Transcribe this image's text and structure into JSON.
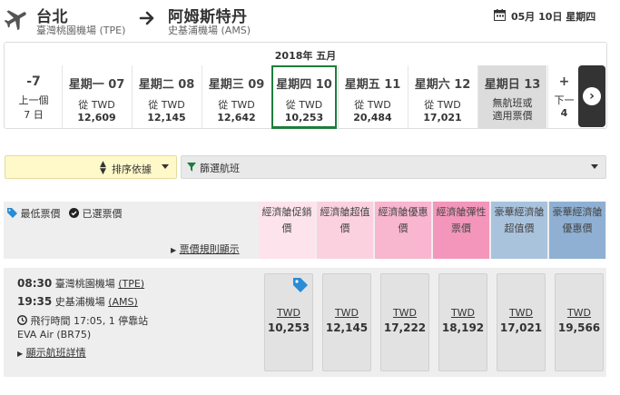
{
  "header": {
    "origin_city": "台北",
    "origin_airport": "臺灣桃園機場 (TPE)",
    "dest_city": "阿姆斯特丹",
    "dest_airport": "史基浦機場 (AMS)",
    "date": "05月 10日 星期四"
  },
  "date_strip": {
    "year_month": "2018年 五月",
    "prev": {
      "label": "-7",
      "line1": "上一個",
      "line2": "7 日"
    },
    "days": [
      {
        "name": "星期一 07",
        "from": "從 TWD",
        "price": "12,609"
      },
      {
        "name": "星期二 08",
        "from": "從 TWD",
        "price": "12,145"
      },
      {
        "name": "星期三 09",
        "from": "從 TWD",
        "price": "12,642"
      },
      {
        "name": "星期四 10",
        "from": "從 TWD",
        "price": "10,253"
      },
      {
        "name": "星期五 11",
        "from": "從 TWD",
        "price": "20,484"
      },
      {
        "name": "星期六 12",
        "from": "從 TWD",
        "price": "17,021"
      },
      {
        "name": "星期日 13",
        "from": "無航班或",
        "price": "適用票價"
      }
    ],
    "next": {
      "label": "+",
      "line1": "下一",
      "line2": "4"
    }
  },
  "sort": {
    "label": "排序依據"
  },
  "filter": {
    "label": "篩選航班"
  },
  "fare_header": {
    "lowest": "最低票價",
    "selected": "已選票價",
    "rules": "票價規則顯示",
    "columns": [
      {
        "label": "經濟艙促銷價",
        "color": "#fde3ec"
      },
      {
        "label": "經濟艙超值價",
        "color": "#fbd1e0"
      },
      {
        "label": "經濟艙優惠價",
        "color": "#f8b6cf"
      },
      {
        "label": "經濟艙彈性票價",
        "color": "#f496bb"
      },
      {
        "label": "豪華經濟艙超值價",
        "color": "#a9c3dd"
      },
      {
        "label": "豪華經濟艙優惠價",
        "color": "#8fb0d2"
      }
    ]
  },
  "flight": {
    "dep_time": "08:30",
    "dep_airport": "臺灣桃園機場",
    "dep_code": "(TPE)",
    "arr_time": "19:35",
    "arr_airport": "史基浦機場",
    "arr_code": "(AMS)",
    "duration": "飛行時間 17:05, 1 停靠站",
    "airline": "EVA Air (BR75)",
    "details": "顯示航班詳情",
    "fares": [
      {
        "currency": "TWD",
        "amount": "10,253"
      },
      {
        "currency": "TWD",
        "amount": "12,145"
      },
      {
        "currency": "TWD",
        "amount": "17,222"
      },
      {
        "currency": "TWD",
        "amount": "18,192"
      },
      {
        "currency": "TWD",
        "amount": "17,021"
      },
      {
        "currency": "TWD",
        "amount": "19,566"
      }
    ]
  }
}
